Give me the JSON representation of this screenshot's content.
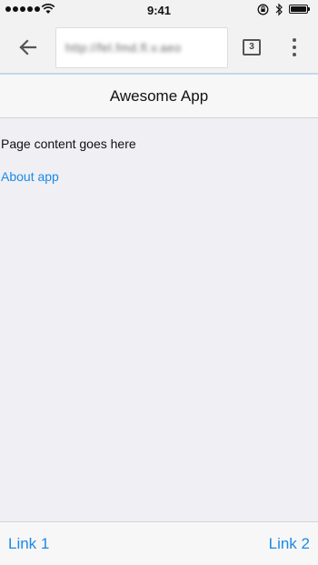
{
  "status_bar": {
    "time": "9:41",
    "icons": [
      "signal-dots-icon",
      "wifi-icon",
      "rotation-lock-icon",
      "bluetooth-icon",
      "battery-icon"
    ]
  },
  "browser": {
    "url": "http://fel.fmd.fl.v.aeo",
    "tab_count": "3",
    "icons": [
      "back-arrow-icon",
      "more-vert-icon"
    ]
  },
  "app": {
    "title": "Awesome App",
    "content_text": "Page content goes here",
    "about_link": "About app"
  },
  "bottom_bar": {
    "link1": "Link 1",
    "link2": "Link 2"
  },
  "colors": {
    "link": "#1a8ae8",
    "background": "#efeff4",
    "bar": "#f7f7f7"
  }
}
